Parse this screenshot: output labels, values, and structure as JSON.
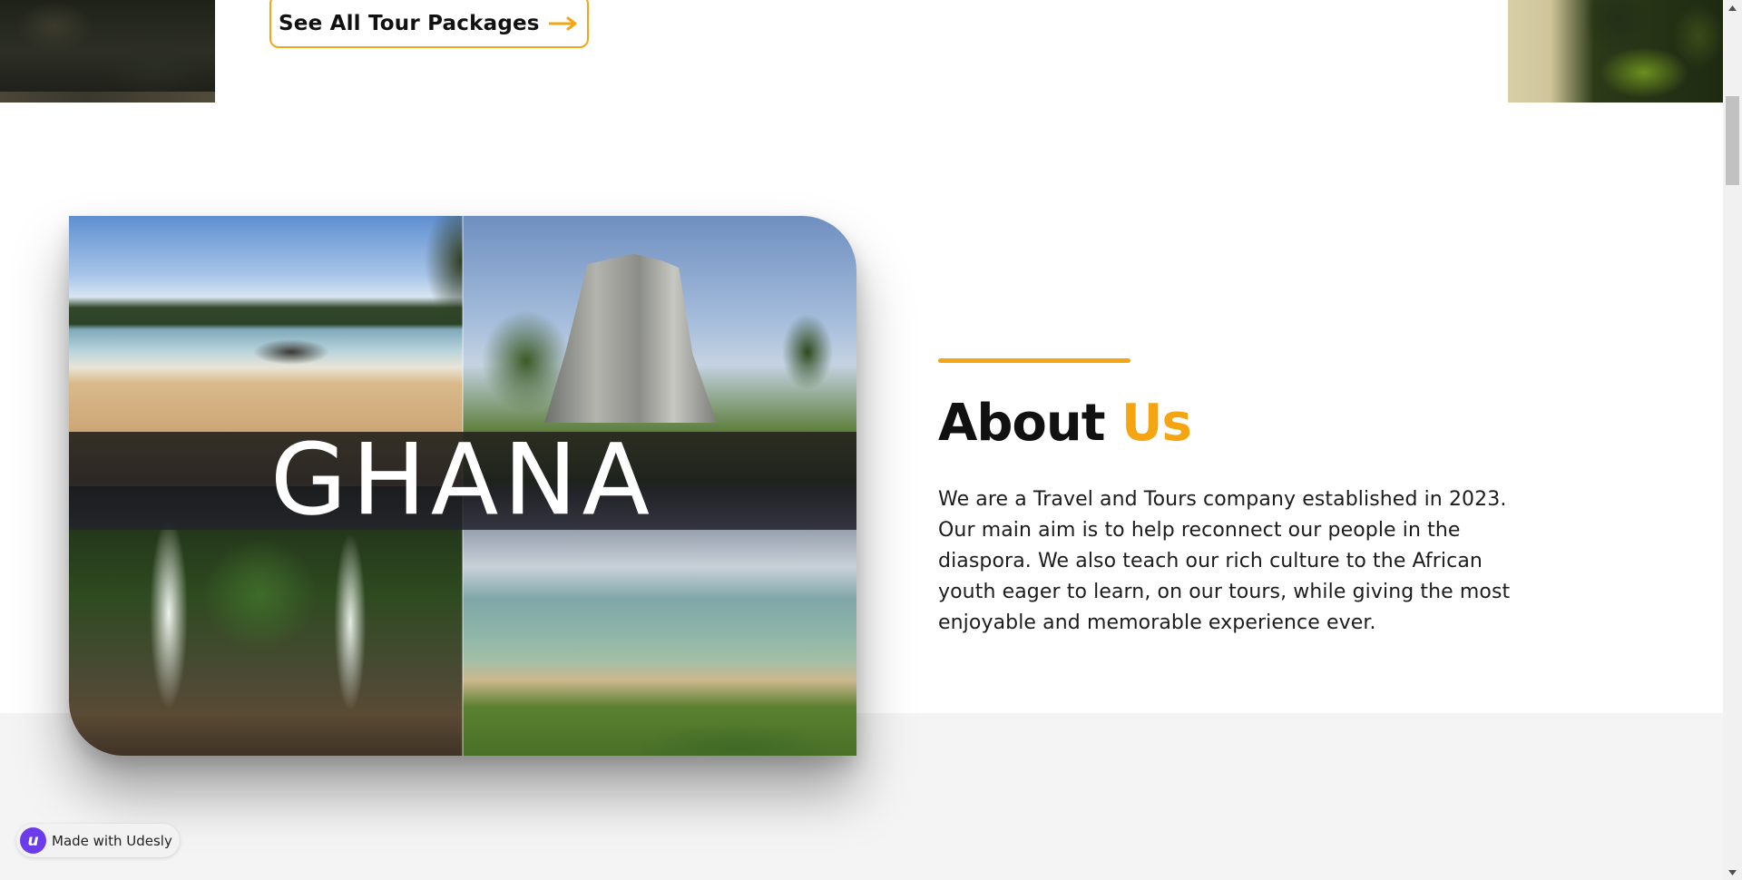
{
  "tours": {
    "cta_label": "See All Tour Packages",
    "cta_icon": "arrow-right-icon"
  },
  "about": {
    "heading_main": "About",
    "heading_accent": "Us",
    "body": "We are a Travel and Tours company established in 2023. Our main aim is to help reconnect our people in the diaspora. We also teach our rich culture to the African youth eager to learn, on our tours, while giving the most enjoyable and memorable experience ever.",
    "image_title": "GHANA",
    "image_tiles": [
      "beach",
      "monument",
      "waterfalls",
      "coastline"
    ]
  },
  "badge": {
    "label": "Made with Udesly",
    "logo_letter": "u"
  },
  "colors": {
    "accent": "#f5a511",
    "text": "#111111",
    "section_alt_bg": "#f4f4f4",
    "badge_logo_bg": "#6c3bea"
  }
}
